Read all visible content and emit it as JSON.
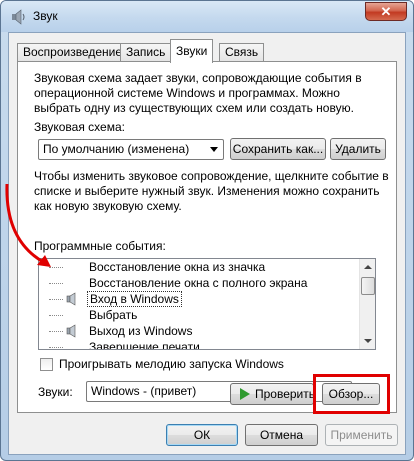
{
  "window": {
    "title": "Звук",
    "close_symbol": "✕"
  },
  "tabs": [
    {
      "label": "Воспроизведение"
    },
    {
      "label": "Запись"
    },
    {
      "label": "Звуки",
      "active": true
    },
    {
      "label": "Связь"
    }
  ],
  "panel": {
    "intro": [
      "Звуковая схема задает звуки, сопровождающие события в",
      "операционной системе Windows и программах. Можно",
      "выбрать одну из существующих схем или создать новую."
    ],
    "scheme_label": "Звуковая схема:",
    "scheme_value": "По умолчанию (изменена)",
    "save_as_label": "Сохранить как...",
    "delete_label": "Удалить",
    "hint": [
      "Чтобы изменить звуковое сопровождение, щелкните событие в",
      "списке и выберите нужный звук. Изменения можно сохранить",
      "как новую звуковую схему."
    ],
    "events_label": "Программные события:",
    "events": [
      {
        "label": "Восстановление окна из значка",
        "has_sound": false
      },
      {
        "label": "Восстановление окна с полного экрана",
        "has_sound": false
      },
      {
        "label": "Вход в Windows",
        "has_sound": true,
        "selected": true
      },
      {
        "label": "Выбрать",
        "has_sound": false
      },
      {
        "label": "Выход из Windows",
        "has_sound": true
      },
      {
        "label": "Завершение печати",
        "has_sound": false
      }
    ],
    "startup_checkbox_label": "Проигрывать мелодию запуска Windows",
    "startup_checked": false,
    "sounds_label": "Звуки:",
    "sounds_value": "Windows - (привет)",
    "test_label": "Проверить",
    "browse_label": "Обзор..."
  },
  "footer": {
    "ok_label": "ОК",
    "cancel_label": "Отмена",
    "apply_label": "Применить"
  },
  "colors": {
    "annotation": "#e00000",
    "play_icon": "#2f9a2f"
  }
}
